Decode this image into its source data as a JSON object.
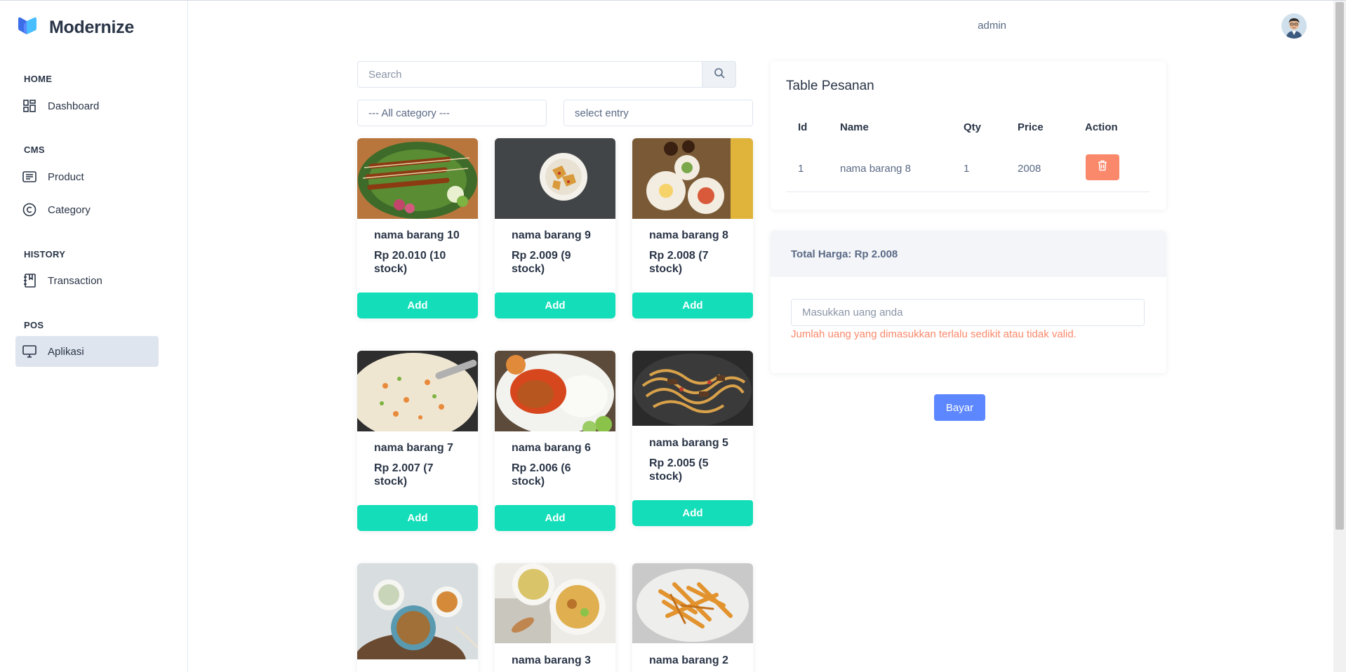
{
  "brand": {
    "name": "Modernize"
  },
  "sidebar": {
    "sections": [
      {
        "title": "HOME",
        "items": [
          {
            "label": "Dashboard",
            "icon": "dashboard-grid-icon"
          }
        ]
      },
      {
        "title": "CMS",
        "items": [
          {
            "label": "Product",
            "icon": "article-icon"
          },
          {
            "label": "Category",
            "icon": "copyright-circle-icon"
          }
        ]
      },
      {
        "title": "HISTORY",
        "items": [
          {
            "label": "Transaction",
            "icon": "notebook-icon"
          }
        ]
      },
      {
        "title": "POS",
        "items": [
          {
            "label": "Aplikasi",
            "icon": "monitor-icon",
            "active": true
          }
        ]
      }
    ]
  },
  "header": {
    "username": "admin"
  },
  "search": {
    "placeholder": "Search"
  },
  "filters": {
    "category": "--- All category ---",
    "entry": "select entry"
  },
  "products": [
    {
      "name": "nama barang 10",
      "price": "Rp 20.010 (10 stock)",
      "add_label": "Add"
    },
    {
      "name": "nama barang 9",
      "price": "Rp 2.009 (9 stock)",
      "add_label": "Add"
    },
    {
      "name": "nama barang 8",
      "price": "Rp 2.008 (7 stock)",
      "add_label": "Add"
    },
    {
      "name": "nama barang 7",
      "price": "Rp 2.007 (7 stock)",
      "add_label": "Add"
    },
    {
      "name": "nama barang 6",
      "price": "Rp 2.006 (6 stock)",
      "add_label": "Add"
    },
    {
      "name": "nama barang 5",
      "price": "Rp 2.005 (5 stock)",
      "add_label": "Add"
    },
    {
      "name": "",
      "price": "",
      "add_label": ""
    },
    {
      "name": "nama barang 3",
      "price": "",
      "add_label": ""
    },
    {
      "name": "nama barang 2",
      "price": "",
      "add_label": ""
    }
  ],
  "order_table": {
    "title": "Table Pesanan",
    "columns": [
      "Id",
      "Name",
      "Qty",
      "Price",
      "Action"
    ],
    "rows": [
      {
        "id": "1",
        "name": "nama barang 8",
        "qty": "1",
        "price": "2008"
      }
    ]
  },
  "payment": {
    "total_label": "Total Harga: Rp 2.008",
    "input_placeholder": "Masukkan uang anda",
    "error": "Jumlah uang yang dimasukkan terlalu sedikit atau tidak valid.",
    "pay_label": "Bayar"
  },
  "colors": {
    "accent": "#5d87ff",
    "add_button": "#13deb9",
    "danger": "#fa896b",
    "active_nav": "#dfe5ef"
  }
}
